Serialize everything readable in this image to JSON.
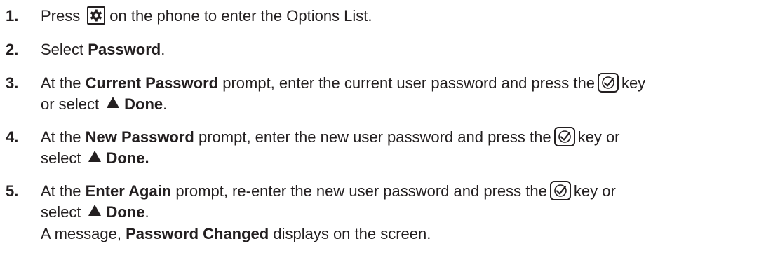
{
  "steps": [
    {
      "number": "1.",
      "before": "Press",
      "icon": "gear-icon",
      "after": "on the phone to enter the Options List."
    },
    {
      "number": "2.",
      "before": "Select ",
      "bold": "Password",
      "after": "."
    },
    {
      "number": "3.",
      "pre": "At the ",
      "prompt": "Current Password",
      "mid": " prompt, enter the current user password and press the",
      "icon": "checkmark-key-icon",
      "post": "key",
      "line2_pre": "or select",
      "softkey_icon": "triangle-softkey-icon",
      "softkey_label": "Done",
      "line2_post": "."
    },
    {
      "number": "4.",
      "pre": "At the ",
      "prompt": "New Password",
      "mid": " prompt, enter the new user password and press the",
      "icon": "checkmark-key-icon",
      "post": "key or",
      "line2_pre": "select",
      "softkey_icon": "triangle-softkey-icon",
      "softkey_label": "Done.",
      "line2_post": ""
    },
    {
      "number": "5.",
      "pre": "At the ",
      "prompt": "Enter Again",
      "mid": " prompt, re-enter the new user password and press the",
      "icon": "checkmark-key-icon",
      "post": "key or",
      "line2_pre": "select",
      "softkey_icon": "triangle-softkey-icon",
      "softkey_label": "Done",
      "line2_post": ".",
      "result_pre": "A message, ",
      "result_bold": "Password Changed",
      "result_post": " displays on the screen."
    }
  ]
}
